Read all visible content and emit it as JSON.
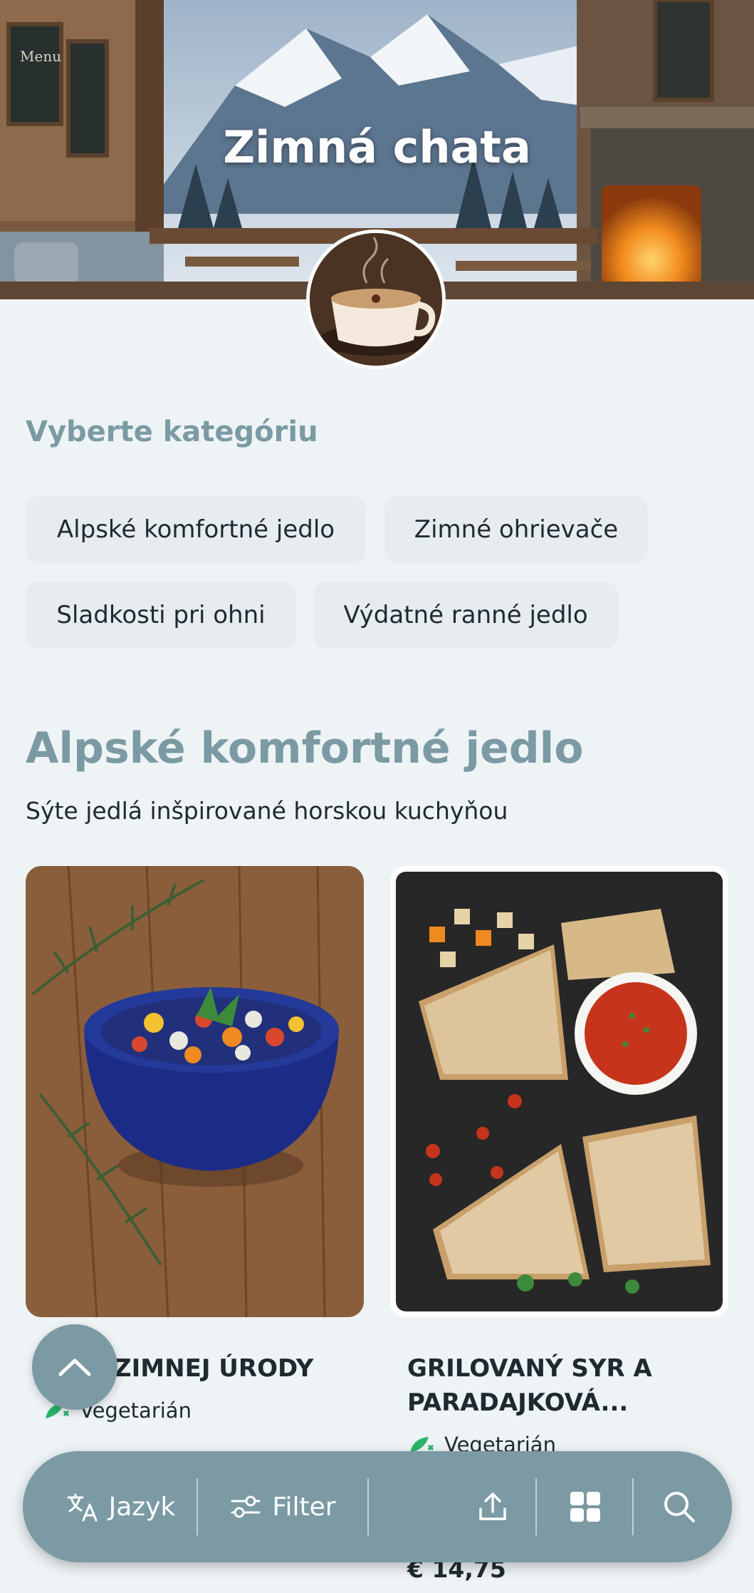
{
  "hero": {
    "title": "Zimná chata"
  },
  "categories_section": {
    "label": "Vyberte kategóriu"
  },
  "category_chips": [
    "Alpské komfortné jedlo",
    "Zimné ohrievače",
    "Sladkosti pri ohni",
    "Výdatné ranné jedlo"
  ],
  "category": {
    "title": "Alpské komfortné jedlo",
    "description": "Sýte jedlá inšpirované horskou kuchyňou"
  },
  "items": [
    {
      "name": "ZIMNEJ ÚRODY",
      "diet": "Vegetarián",
      "price": ""
    },
    {
      "name_line1": "GRILOVANÝ SYR A",
      "name_line2": "PARADAJKOVÁ...",
      "diet": "Vegetarián",
      "price": "€ 14,75"
    }
  ],
  "bottom_bar": {
    "language_label": "Jazyk",
    "filter_label": "Filter",
    "icons": [
      "translate-icon",
      "filter-icon",
      "share-icon",
      "grid-icon",
      "search-icon"
    ]
  },
  "colors": {
    "accent": "#7b9aa4",
    "background": "#eef3f5",
    "chip": "#e6ecef",
    "text": "#1e2a30",
    "vegetarian": "#2bb36b"
  }
}
